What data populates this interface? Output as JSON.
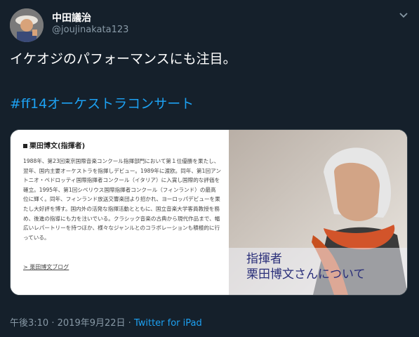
{
  "user": {
    "display_name": "中田議治",
    "handle": "@joujinakata123"
  },
  "tweet": {
    "text": "イケオジのパフォーマンスにも注目。",
    "hashtag": "#ff14オーケストラコンサート"
  },
  "card": {
    "heading": "栗田博文(指揮者)",
    "body": "1988年、第23回東京国際音楽コンクール指揮部門において第１位優勝を果たし、翌年、国内主要オーケストラを指揮しデビュー。1989年に渡欧。同年、第1回アントニオ・ペドロッティ国際指揮者コンクール（イタリア）に入賞し国際的な評価を確立。1995年、第1回シベリウス国際指揮者コンクール（フィンランド）の最高位に輝く。同年、フィンランド放送交響楽団より招かれ、ヨーロッパデビューを果たし大好評を博す。国内外の活発な指揮活動とともに、国立音楽大学客員教授を務め、後進の指導にも力を注いでいる。クラシック音楽の古典から現代作品まで、幅広いレパートリーを持つほか、様々なジャンルとのコラボレーションも積極的に行っている。",
    "link": "> 栗田博文ブログ",
    "caption": "指揮者\n栗田博文さんについて"
  },
  "footer": {
    "time": "午後3:10",
    "date": "2019年9月22日",
    "source": "Twitter for iPad",
    "separator": "·"
  },
  "colors": {
    "background": "#15202b",
    "link": "#1da1f2",
    "muted": "#8899a6"
  }
}
